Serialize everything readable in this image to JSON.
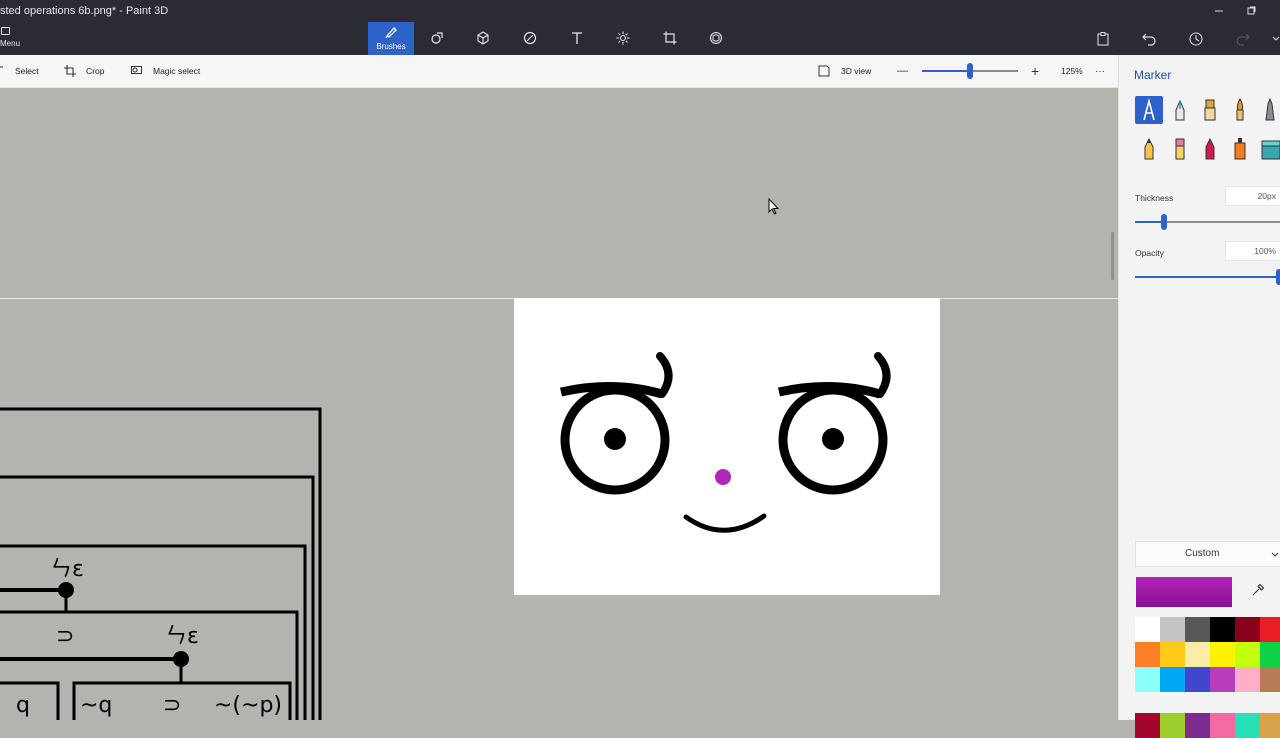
{
  "window": {
    "title": "sted operations 6b.png* - Paint 3D",
    "controls": [
      "minimize",
      "restore"
    ]
  },
  "ribbon": {
    "menu_label": "Menu",
    "active_tool_label": "Brushes",
    "tools": [
      "brushes",
      "2d-shapes",
      "3d-shapes",
      "stickers",
      "text",
      "effects",
      "canvas",
      "3d-library"
    ],
    "right_icons": [
      "paste",
      "undo",
      "history",
      "redo"
    ]
  },
  "toolbar": {
    "select_label": "Select",
    "crop_label": "Crop",
    "magic_select_label": "Magic select",
    "view_3d_label": "3D view",
    "zoom_minus": "—",
    "zoom_plus": "+",
    "zoom_level": "125%",
    "more_label": "···"
  },
  "panel": {
    "title": "Marker",
    "brushes": [
      "marker",
      "calligraphy-pen",
      "oil-brush",
      "watercolor",
      "pixel-pen",
      "pencil",
      "eraser",
      "crayon",
      "spray-can",
      "fill"
    ],
    "selected_brush": "marker",
    "thickness_label": "Thickness",
    "thickness_value": "20px",
    "thickness_fraction": 0.2,
    "opacity_label": "Opacity",
    "opacity_value": "100%",
    "opacity_fraction": 1.0,
    "color_mode_label": "Custom",
    "current_color": "#b026b6",
    "palette": [
      "#ffffff",
      "#c3c3c3",
      "#585858",
      "#000000",
      "#88001b",
      "#ec1c24",
      "#ff7f27",
      "#ffca18",
      "#fdeca6",
      "#fff200",
      "#c4ff0e",
      "#0ed145",
      "#8cfffb",
      "#00a8f3",
      "#3f48cc",
      "#b83dba",
      "#ffaec8",
      "#b97a56",
      "#a3062c",
      "#9dce2e",
      "#7d2b8f",
      "#f36ca1",
      "#28e0b6",
      "#d8a34a"
    ]
  },
  "canvas": {
    "face": {
      "left_eye": "ठ",
      "right_eye": "ठ",
      "nose_color": "#b026b6"
    },
    "diagram_labels": [
      "ㄣɛ",
      "⊃",
      "ㄣɛ",
      "q",
      "~q",
      "⊃",
      "~(~p)"
    ]
  }
}
